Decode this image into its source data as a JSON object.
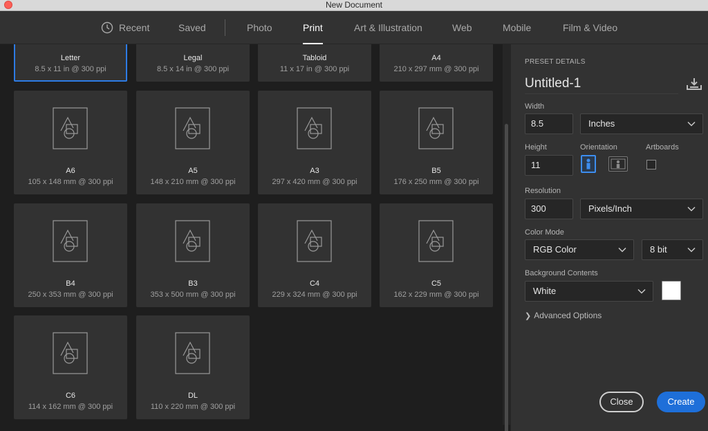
{
  "window": {
    "title": "New Document"
  },
  "tabs": [
    {
      "label": "Recent"
    },
    {
      "label": "Saved"
    },
    {
      "label": "Photo"
    },
    {
      "label": "Print"
    },
    {
      "label": "Art & Illustration"
    },
    {
      "label": "Web"
    },
    {
      "label": "Mobile"
    },
    {
      "label": "Film & Video"
    }
  ],
  "presets": [
    {
      "name": "Letter",
      "desc": "8.5 x 11 in @ 300 ppi"
    },
    {
      "name": "Legal",
      "desc": "8.5 x 14 in @ 300 ppi"
    },
    {
      "name": "Tabloid",
      "desc": "11 x 17 in @ 300 ppi"
    },
    {
      "name": "A4",
      "desc": "210 x 297 mm @ 300 ppi"
    },
    {
      "name": "A6",
      "desc": "105 x 148 mm @ 300 ppi"
    },
    {
      "name": "A5",
      "desc": "148 x 210 mm @ 300 ppi"
    },
    {
      "name": "A3",
      "desc": "297 x 420 mm @ 300 ppi"
    },
    {
      "name": "B5",
      "desc": "176 x 250 mm @ 300 ppi"
    },
    {
      "name": "B4",
      "desc": "250 x 353 mm @ 300 ppi"
    },
    {
      "name": "B3",
      "desc": "353 x 500 mm @ 300 ppi"
    },
    {
      "name": "C4",
      "desc": "229 x 324 mm @ 300 ppi"
    },
    {
      "name": "C5",
      "desc": "162 x 229 mm @ 300 ppi"
    },
    {
      "name": "C6",
      "desc": "114 x 162 mm @ 300 ppi"
    },
    {
      "name": "DL",
      "desc": "110 x 220 mm @ 300 ppi"
    }
  ],
  "details": {
    "heading": "PRESET DETAILS",
    "preset_name": "Untitled-1",
    "width_label": "Width",
    "width_value": "8.5",
    "width_unit": "Inches",
    "height_label": "Height",
    "height_value": "11",
    "orientation_label": "Orientation",
    "artboards_label": "Artboards",
    "resolution_label": "Resolution",
    "resolution_value": "300",
    "resolution_unit": "Pixels/Inch",
    "color_mode_label": "Color Mode",
    "color_mode": "RGB Color",
    "bit_depth": "8 bit",
    "background_label": "Background Contents",
    "background": "White",
    "advanced": "Advanced Options"
  },
  "buttons": {
    "close": "Close",
    "create": "Create"
  },
  "colors": {
    "accent": "#1e6fd9",
    "selection": "#2d7be5",
    "panel": "#323232",
    "background": "#1e1e1e"
  }
}
